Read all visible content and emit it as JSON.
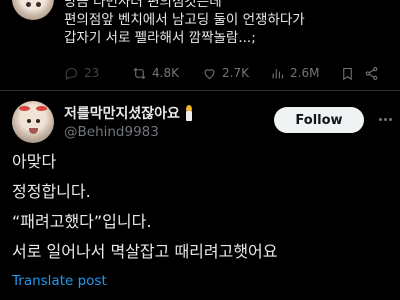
{
  "previous_tweet": {
    "lines": [
      "방금 라면사러 편의점갓는데",
      "편의점앞 벤치에서 남고딩 둘이 언쟁하다가",
      "갑자기 서로 펠라해서 깜짝놀람...;"
    ],
    "stats": {
      "replies": "23",
      "retweets": "4.8K",
      "likes": "2.7K",
      "views": "2.6M"
    }
  },
  "tweet": {
    "display_name": "저를막만지셨잖아요",
    "handle": "@Behind9983",
    "follow_label": "Follow",
    "lines": [
      "아맞다",
      "정정합니다.",
      "“패려고했다”입니다.",
      "서로 일어나서 멱살잡고 때리려고햇어요"
    ],
    "translate_label": "Translate post"
  },
  "colors": {
    "background": "#000000",
    "text": "#e7e9ea",
    "muted": "#71767b",
    "link": "#1d9bf0",
    "divider": "#2f3336",
    "follow_bg": "#eff3f4"
  },
  "icons": [
    "reply-icon",
    "retweet-icon",
    "like-icon",
    "views-icon",
    "bookmark-icon",
    "share-icon",
    "candle-icon",
    "more-icon"
  ]
}
